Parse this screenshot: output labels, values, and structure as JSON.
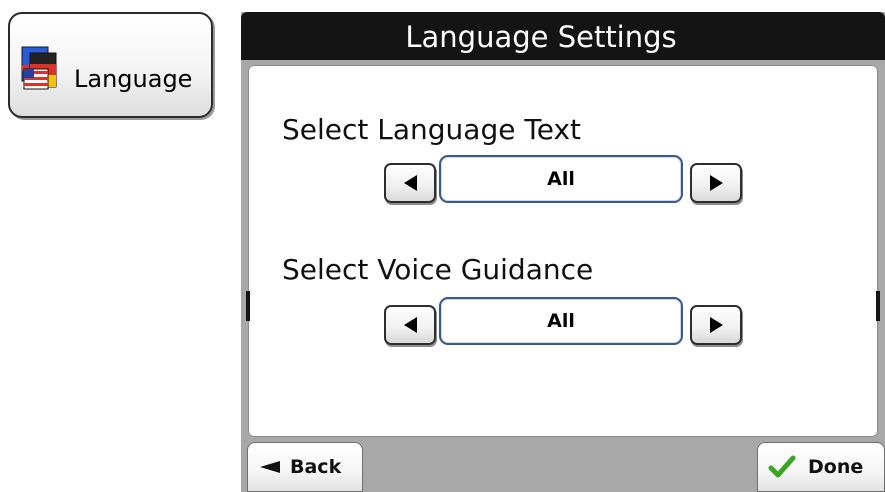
{
  "sidebar_tile": {
    "label": "Language",
    "icon": "language-flags-icon"
  },
  "panel": {
    "title": "Language Settings",
    "sections": [
      {
        "label": "Select Language Text",
        "value": "All"
      },
      {
        "label": "Select Voice Guidance",
        "value": "All"
      }
    ]
  },
  "footer": {
    "back_label": "Back",
    "done_label": "Done"
  },
  "colors": {
    "header_bg": "#141414",
    "panel_bg": "#a8a8a8",
    "field_border": "#3a5a8c",
    "check_green": "#3aa51f"
  }
}
